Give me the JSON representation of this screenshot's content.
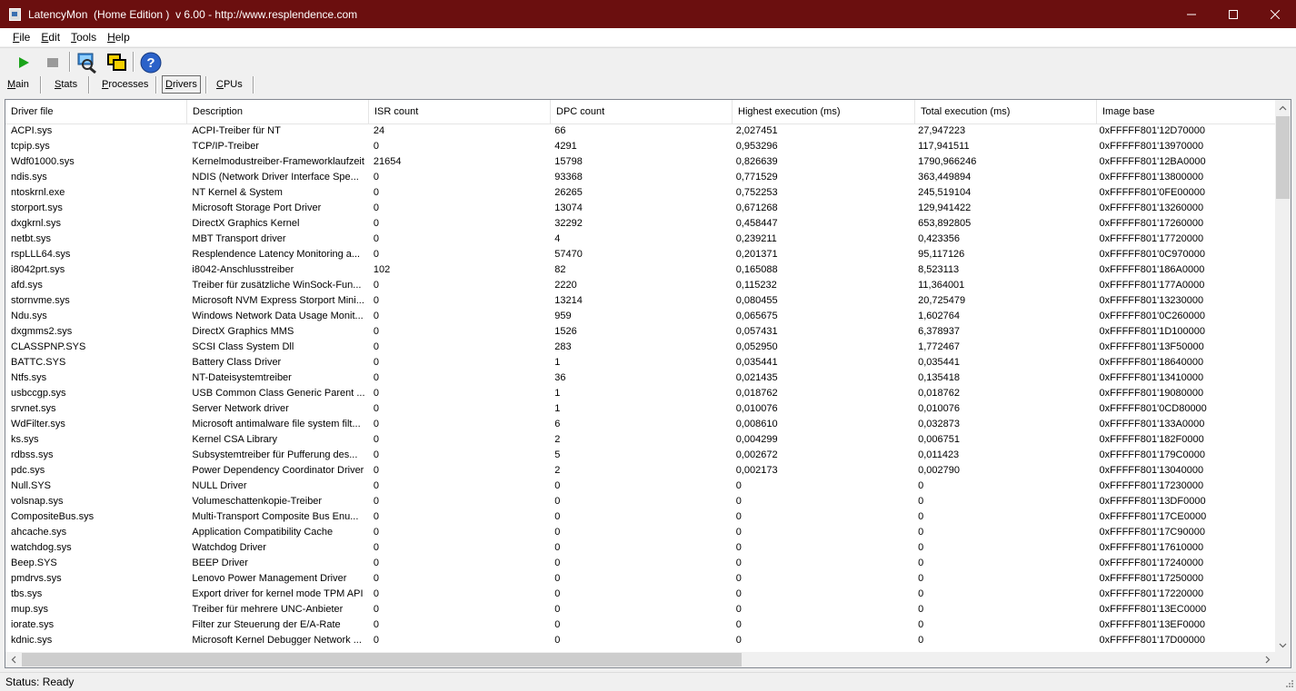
{
  "window": {
    "title": "LatencyMon  (Home Edition )  v 6.00 - http://www.resplendence.com"
  },
  "menu": [
    "File",
    "Edit",
    "Tools",
    "Help"
  ],
  "toolbar": {
    "icons": [
      "play-icon",
      "stop-icon",
      "scan-icon",
      "windows-icon",
      "help-icon"
    ]
  },
  "tabs": [
    "Main",
    "Stats",
    "Processes",
    "Drivers",
    "CPUs"
  ],
  "active_tab": "Drivers",
  "table": {
    "columns": [
      "Driver file",
      "Description",
      "ISR count",
      "DPC count",
      "Highest execution (ms)",
      "Total execution (ms)",
      "Image base"
    ],
    "rows": [
      [
        "ACPI.sys",
        "ACPI-Treiber für NT",
        "24",
        "66",
        "2,027451",
        "27,947223",
        "0xFFFFF801'12D70000"
      ],
      [
        "tcpip.sys",
        "TCP/IP-Treiber",
        "0",
        "4291",
        "0,953296",
        "117,941511",
        "0xFFFFF801'13970000"
      ],
      [
        "Wdf01000.sys",
        "Kernelmodustreiber-Frameworklaufzeit",
        "21654",
        "15798",
        "0,826639",
        "1790,966246",
        "0xFFFFF801'12BA0000"
      ],
      [
        "ndis.sys",
        "NDIS (Network Driver Interface Spe...",
        "0",
        "93368",
        "0,771529",
        "363,449894",
        "0xFFFFF801'13800000"
      ],
      [
        "ntoskrnl.exe",
        "NT Kernel & System",
        "0",
        "26265",
        "0,752253",
        "245,519104",
        "0xFFFFF801'0FE00000"
      ],
      [
        "storport.sys",
        "Microsoft Storage Port Driver",
        "0",
        "13074",
        "0,671268",
        "129,941422",
        "0xFFFFF801'13260000"
      ],
      [
        "dxgkrnl.sys",
        "DirectX Graphics Kernel",
        "0",
        "32292",
        "0,458447",
        "653,892805",
        "0xFFFFF801'17260000"
      ],
      [
        "netbt.sys",
        "MBT Transport driver",
        "0",
        "4",
        "0,239211",
        "0,423356",
        "0xFFFFF801'17720000"
      ],
      [
        "rspLLL64.sys",
        "Resplendence Latency Monitoring a...",
        "0",
        "57470",
        "0,201371",
        "95,117126",
        "0xFFFFF801'0C970000"
      ],
      [
        "i8042prt.sys",
        "i8042-Anschlusstreiber",
        "102",
        "82",
        "0,165088",
        "8,523113",
        "0xFFFFF801'186A0000"
      ],
      [
        "afd.sys",
        "Treiber für zusätzliche WinSock-Fun...",
        "0",
        "2220",
        "0,115232",
        "11,364001",
        "0xFFFFF801'177A0000"
      ],
      [
        "stornvme.sys",
        "Microsoft NVM Express Storport Mini...",
        "0",
        "13214",
        "0,080455",
        "20,725479",
        "0xFFFFF801'13230000"
      ],
      [
        "Ndu.sys",
        "Windows Network Data Usage Monit...",
        "0",
        "959",
        "0,065675",
        "1,602764",
        "0xFFFFF801'0C260000"
      ],
      [
        "dxgmms2.sys",
        "DirectX Graphics MMS",
        "0",
        "1526",
        "0,057431",
        "6,378937",
        "0xFFFFF801'1D100000"
      ],
      [
        "CLASSPNP.SYS",
        "SCSI Class System Dll",
        "0",
        "283",
        "0,052950",
        "1,772467",
        "0xFFFFF801'13F50000"
      ],
      [
        "BATTC.SYS",
        "Battery Class Driver",
        "0",
        "1",
        "0,035441",
        "0,035441",
        "0xFFFFF801'18640000"
      ],
      [
        "Ntfs.sys",
        "NT-Dateisystemtreiber",
        "0",
        "36",
        "0,021435",
        "0,135418",
        "0xFFFFF801'13410000"
      ],
      [
        "usbccgp.sys",
        "USB Common Class Generic Parent ...",
        "0",
        "1",
        "0,018762",
        "0,018762",
        "0xFFFFF801'19080000"
      ],
      [
        "srvnet.sys",
        "Server Network driver",
        "0",
        "1",
        "0,010076",
        "0,010076",
        "0xFFFFF801'0CD80000"
      ],
      [
        "WdFilter.sys",
        "Microsoft antimalware file system filt...",
        "0",
        "6",
        "0,008610",
        "0,032873",
        "0xFFFFF801'133A0000"
      ],
      [
        "ks.sys",
        "Kernel CSA Library",
        "0",
        "2",
        "0,004299",
        "0,006751",
        "0xFFFFF801'182F0000"
      ],
      [
        "rdbss.sys",
        "Subsystemtreiber für Pufferung des...",
        "0",
        "5",
        "0,002672",
        "0,011423",
        "0xFFFFF801'179C0000"
      ],
      [
        "pdc.sys",
        "Power Dependency Coordinator Driver",
        "0",
        "2",
        "0,002173",
        "0,002790",
        "0xFFFFF801'13040000"
      ],
      [
        "Null.SYS",
        "NULL Driver",
        "0",
        "0",
        "0",
        "0",
        "0xFFFFF801'17230000"
      ],
      [
        "volsnap.sys",
        "Volumeschattenkopie-Treiber",
        "0",
        "0",
        "0",
        "0",
        "0xFFFFF801'13DF0000"
      ],
      [
        "CompositeBus.sys",
        "Multi-Transport Composite Bus Enu...",
        "0",
        "0",
        "0",
        "0",
        "0xFFFFF801'17CE0000"
      ],
      [
        "ahcache.sys",
        "Application Compatibility Cache",
        "0",
        "0",
        "0",
        "0",
        "0xFFFFF801'17C90000"
      ],
      [
        "watchdog.sys",
        "Watchdog Driver",
        "0",
        "0",
        "0",
        "0",
        "0xFFFFF801'17610000"
      ],
      [
        "Beep.SYS",
        "BEEP Driver",
        "0",
        "0",
        "0",
        "0",
        "0xFFFFF801'17240000"
      ],
      [
        "pmdrvs.sys",
        "Lenovo Power Management Driver",
        "0",
        "0",
        "0",
        "0",
        "0xFFFFF801'17250000"
      ],
      [
        "tbs.sys",
        "Export driver for kernel mode TPM API",
        "0",
        "0",
        "0",
        "0",
        "0xFFFFF801'17220000"
      ],
      [
        "mup.sys",
        "Treiber für mehrere UNC-Anbieter",
        "0",
        "0",
        "0",
        "0",
        "0xFFFFF801'13EC0000"
      ],
      [
        "iorate.sys",
        "Filter zur Steuerung der E/A-Rate",
        "0",
        "0",
        "0",
        "0",
        "0xFFFFF801'13EF0000"
      ],
      [
        "kdnic.sys",
        "Microsoft Kernel Debugger Network ...",
        "0",
        "0",
        "0",
        "0",
        "0xFFFFF801'17D00000"
      ]
    ]
  },
  "status": "Status: Ready"
}
